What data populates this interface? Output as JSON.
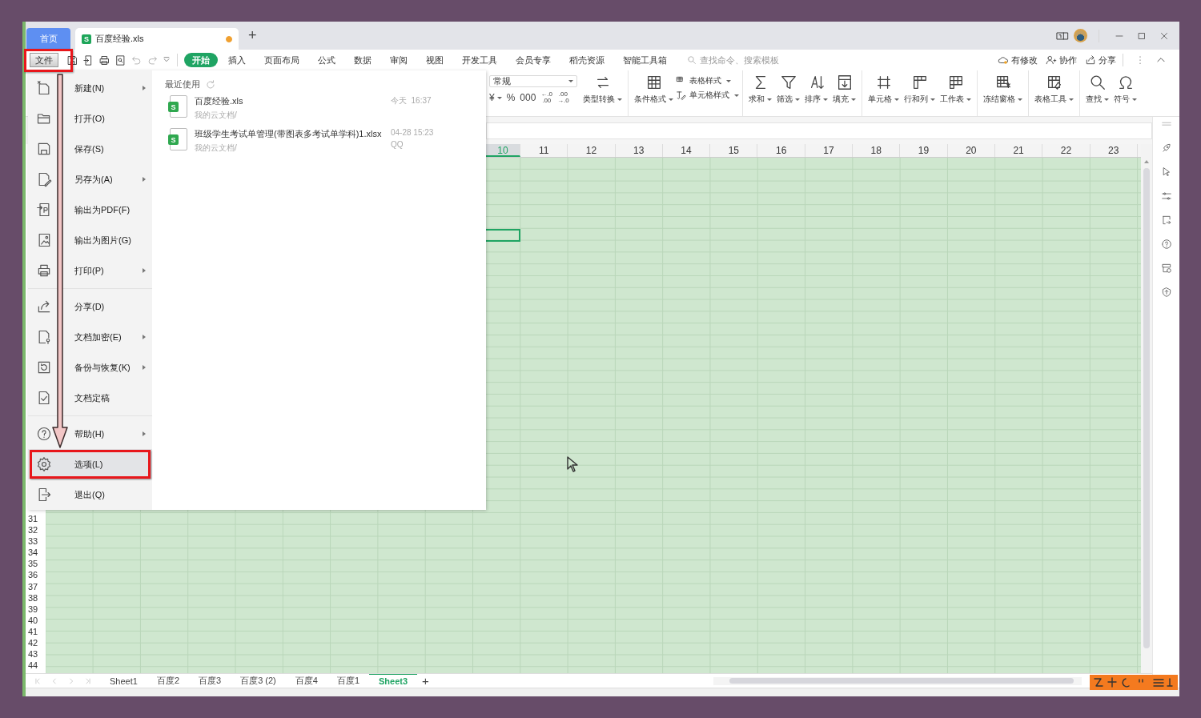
{
  "title_bar": {
    "home_tab": "首页",
    "document_tab": {
      "badge": "S",
      "name": "百度经验.xls",
      "unsaved": true
    },
    "new_tab": "+"
  },
  "menu_bar": {
    "file_button": "文件",
    "tabs": [
      {
        "label": "开始",
        "selected": true
      },
      {
        "label": "插入",
        "selected": false
      },
      {
        "label": "页面布局",
        "selected": false
      },
      {
        "label": "公式",
        "selected": false
      },
      {
        "label": "数据",
        "selected": false
      },
      {
        "label": "审阅",
        "selected": false
      },
      {
        "label": "视图",
        "selected": false
      },
      {
        "label": "开发工具",
        "selected": false
      },
      {
        "label": "会员专享",
        "selected": false
      },
      {
        "label": "稻壳资源",
        "selected": false
      },
      {
        "label": "智能工具箱",
        "selected": false
      }
    ],
    "search": {
      "placeholder": "查找命令、搜索模板"
    },
    "actions": [
      "有修改",
      "协作",
      "分享"
    ]
  },
  "ribbon": {
    "number_format": {
      "value": "常规"
    },
    "format_buttons": [
      {
        "kind": "single",
        "label": "¥",
        "dropdown": true
      },
      {
        "kind": "single",
        "label": "%",
        "dropdown": false
      },
      {
        "kind": "single",
        "label": "000",
        "dropdown": false
      },
      {
        "kind": "stacked",
        "top": "←.0",
        "bottom": ".00"
      },
      {
        "kind": "stacked",
        "top": ".00",
        "bottom": "→.0"
      }
    ],
    "groups": [
      [
        {
          "kind": "large",
          "label": "类型转换"
        }
      ],
      [
        {
          "kind": "large",
          "label": "条件格式"
        },
        {
          "kind": "stack",
          "items": [
            "表格样式",
            "单元格样式"
          ]
        }
      ],
      [
        {
          "kind": "large",
          "label": "求和"
        },
        {
          "kind": "large",
          "label": "筛选"
        },
        {
          "kind": "large",
          "label": "排序"
        },
        {
          "kind": "large",
          "label": "填充"
        }
      ],
      [
        {
          "kind": "large",
          "label": "单元格"
        },
        {
          "kind": "large",
          "label": "行和列"
        },
        {
          "kind": "large",
          "label": "工作表"
        }
      ],
      [
        {
          "kind": "large",
          "label": "冻结窗格"
        }
      ],
      [
        {
          "kind": "large",
          "label": "表格工具"
        }
      ],
      [
        {
          "kind": "large",
          "label": "查找"
        },
        {
          "kind": "large",
          "label": "符号"
        }
      ]
    ]
  },
  "sheet": {
    "columns": [
      {
        "label": "10",
        "selected": true
      },
      {
        "label": "11",
        "selected": false
      },
      {
        "label": "12",
        "selected": false
      },
      {
        "label": "13",
        "selected": false
      },
      {
        "label": "14",
        "selected": false
      },
      {
        "label": "15",
        "selected": false
      },
      {
        "label": "16",
        "selected": false
      },
      {
        "label": "17",
        "selected": false
      },
      {
        "label": "18",
        "selected": false
      },
      {
        "label": "19",
        "selected": false
      },
      {
        "label": "20",
        "selected": false
      },
      {
        "label": "21",
        "selected": false
      },
      {
        "label": "22",
        "selected": false
      },
      {
        "label": "23",
        "selected": false
      }
    ],
    "rows": [
      "31",
      "32",
      "33",
      "34",
      "35",
      "36",
      "37",
      "38",
      "39",
      "40",
      "41",
      "42",
      "43",
      "44"
    ]
  },
  "sheet_tabs": [
    {
      "label": "Sheet1",
      "selected": false
    },
    {
      "label": "百度2",
      "selected": false
    },
    {
      "label": "百度3",
      "selected": false
    },
    {
      "label": "百度3 (2)",
      "selected": false
    },
    {
      "label": "百度4",
      "selected": false
    },
    {
      "label": "百度1",
      "selected": false
    },
    {
      "label": "Sheet3",
      "selected": true
    }
  ],
  "add_sheet": "+",
  "file_menu": {
    "groups": [
      [
        {
          "label": "新建(N)",
          "submenu": true,
          "selected": false
        },
        {
          "label": "打开(O)",
          "submenu": false,
          "selected": false
        },
        {
          "label": "保存(S)",
          "submenu": false,
          "selected": false
        },
        {
          "label": "另存为(A)",
          "submenu": true,
          "selected": false
        },
        {
          "label": "输出为PDF(F)",
          "submenu": false,
          "selected": false
        },
        {
          "label": "输出为图片(G)",
          "submenu": false,
          "selected": false
        },
        {
          "label": "打印(P)",
          "submenu": true,
          "selected": false
        }
      ],
      [
        {
          "label": "分享(D)",
          "submenu": false,
          "selected": false
        },
        {
          "label": "文档加密(E)",
          "submenu": true,
          "selected": false
        },
        {
          "label": "备份与恢复(K)",
          "submenu": true,
          "selected": false
        },
        {
          "label": "文档定稿",
          "submenu": false,
          "selected": false
        }
      ],
      [
        {
          "label": "帮助(H)",
          "submenu": true,
          "selected": false
        },
        {
          "label": "选项(L)",
          "submenu": false,
          "selected": true
        },
        {
          "label": "退出(Q)",
          "submenu": false,
          "selected": false
        }
      ]
    ],
    "recent": {
      "title": "最近使用",
      "files": [
        {
          "badge": "S",
          "name": "百度经验.xls",
          "location": "我的云文档/",
          "time": "今天  16:37"
        },
        {
          "badge": "S",
          "name": "班级学生考试单管理(带图表多考试单学科)1.xlsx",
          "location": "我的云文档/",
          "time": "04-28 15:23",
          "source": "QQ"
        }
      ]
    }
  }
}
